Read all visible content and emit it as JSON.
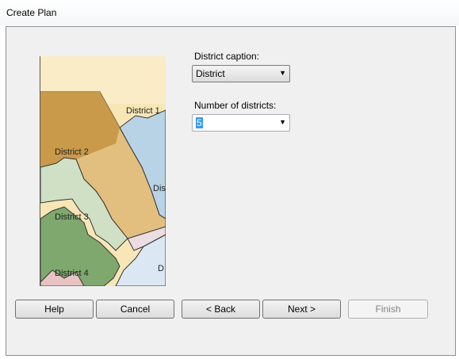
{
  "window": {
    "title": "Create Plan"
  },
  "illustration": {
    "district_labels": [
      "District 1",
      "District 2",
      "Dis",
      "District 3",
      "D",
      "District 4"
    ]
  },
  "district_caption": {
    "label": "District caption:",
    "value": "District"
  },
  "number_of_districts": {
    "label": "Number of districts:",
    "value": "5"
  },
  "buttons": {
    "help": "Help",
    "cancel": "Cancel",
    "back": "< Back",
    "next": "Next >",
    "finish": "Finish"
  },
  "colors": {
    "district1": "#f8e6b6",
    "district2": "#c99a4a",
    "district_blue": "#b9d3e6",
    "district3": "#cfe0c4",
    "district4": "#7fa86e",
    "district_pink": "#e7c3c3"
  }
}
